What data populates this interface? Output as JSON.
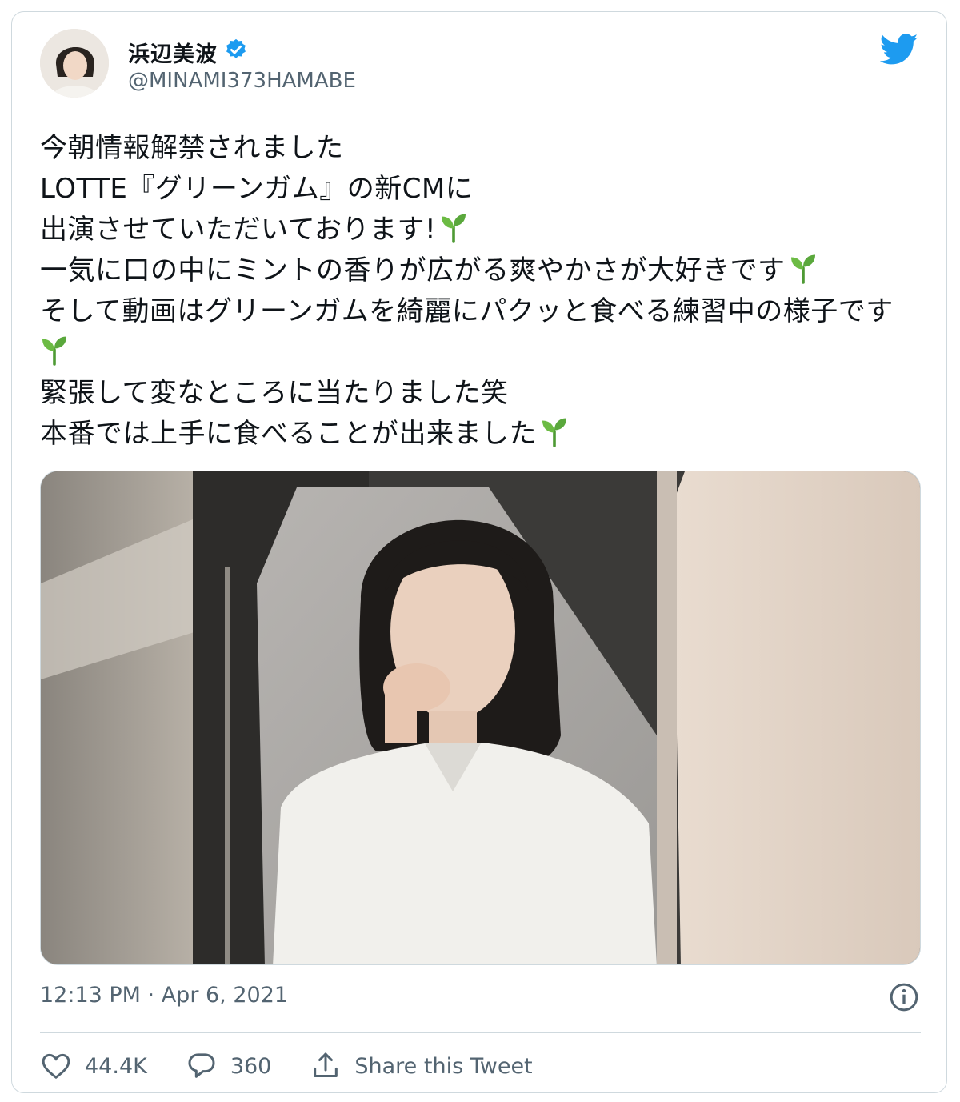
{
  "author": {
    "display_name": "浜辺美波",
    "handle": "@MINAMI373HAMABE",
    "verified": true
  },
  "tweet": {
    "lines": [
      {
        "text": "今朝情報解禁されました",
        "sprout": false
      },
      {
        "text": "LOTTE『グリーンガム』の新CMに",
        "sprout": false
      },
      {
        "text": "出演させていただいております!",
        "sprout": true
      },
      {
        "text": "一気に口の中にミントの香りが広がる爽やかさが大好きです",
        "sprout": true
      },
      {
        "text": "そして動画はグリーンガムを綺麗にパクッと食べる練習中の様子です",
        "sprout": false
      },
      {
        "text": "",
        "sprout": true
      },
      {
        "text": "緊張して変なところに当たりました笑",
        "sprout": false
      },
      {
        "text": "本番では上手に食べることが出来ました",
        "sprout": true
      }
    ],
    "timestamp": "12:13 PM · Apr 6, 2021"
  },
  "actions": {
    "likes": "44.4K",
    "replies": "360",
    "share_label": "Share this Tweet"
  },
  "icons": {
    "brand": "twitter-bird-icon",
    "verified": "verified-badge-icon",
    "sprout": "seedling-emoji-icon",
    "info": "info-icon",
    "like": "heart-icon",
    "reply": "reply-bubble-icon",
    "share": "share-upload-icon"
  },
  "colors": {
    "twitter_blue": "#1d9bf0",
    "secondary_text": "#536471",
    "sprout_green": "#5aa83c"
  }
}
